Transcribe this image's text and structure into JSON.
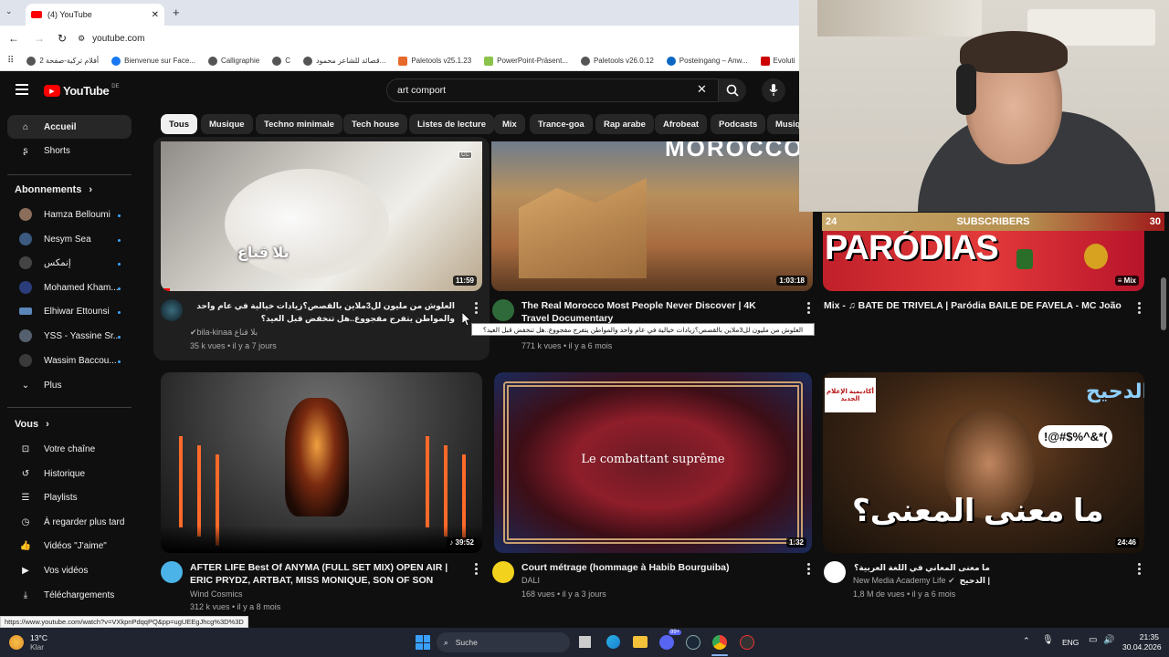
{
  "browser": {
    "tab_title": "(4) YouTube",
    "url": "youtube.com",
    "bookmarks": [
      "أفلام تركية-صفحة 2",
      "Bienvenue sur Face...",
      "Calligraphie",
      "C",
      "قصائد للشاعر محمود...",
      "Paletools v25.1.23",
      "PowerPoint-Präsent...",
      "Paletools v26.0.12",
      "Posteingang – Anw...",
      "Evoluti"
    ]
  },
  "youtube": {
    "logo_text": "YouTube",
    "region": "DE",
    "search_value": "art comport",
    "sidebar": {
      "main": [
        "Accueil",
        "Shorts"
      ],
      "subscriptions_heading": "Abonnements",
      "subscriptions": [
        "Hamza Belloumi",
        "Nesym Sea",
        "إنمكس",
        "Mohamed Kham...",
        "Elhiwar Ettounsi",
        "YSS - Yassine Sr...",
        "Wassim Baccou...",
        "Plus"
      ],
      "you_heading": "Vous",
      "you_items": [
        "Votre chaîne",
        "Historique",
        "Playlists",
        "À regarder plus tard",
        "Vidéos \"J'aime\"",
        "Vos vidéos",
        "Téléchargements"
      ]
    },
    "chips": [
      "Tous",
      "Musique",
      "Techno minimale",
      "Tech house",
      "Listes de lecture",
      "Mix",
      "Trance-goa",
      "Rap arabe",
      "Afrobeat",
      "Podcasts",
      "Musiq"
    ],
    "videos": [
      {
        "title": "العلوش من مليون لل3ملاين بالقصص؟زيادات خيالية في عام واحد والمواطن يتفرج مفجووع..هل تنخفض قبل العيد؟",
        "channel": "bila-kinaa بلا قناع",
        "meta": "35 k vues • il y a 7 jours",
        "duration": "11:59",
        "thumb_text": "بلا قناع"
      },
      {
        "title": "The Real Morocco Most People Never Discover | 4K Travel Documentary",
        "channel": "",
        "meta": "771 k vues • il y a 6 mois",
        "duration": "1:03:18",
        "thumb_text": "MOROCCO"
      },
      {
        "title": "Mix - ♫ BATE DE TRIVELA | Paródia BAILE DE FAVELA - MC João",
        "channel": "",
        "meta": "",
        "duration": "Mix",
        "thumb_text": "PARÓDIAS"
      },
      {
        "title": "AFTER LIFE Best Of ANYMA (FULL SET MIX) OPEN AIR | ERIC PRYDZ, ARTBAT, MISS MONIQUE, SON OF SON",
        "channel": "Wind Cosmics",
        "meta": "312 k vues • il y a 8 mois",
        "duration": "39:52",
        "thumb_text": ""
      },
      {
        "title": "Court métrage (hommage à Habib Bourguiba)",
        "channel": "DALI",
        "meta": "168 vues • il y a 3 jours",
        "duration": "1:32",
        "thumb_text": "Le combattant suprême"
      },
      {
        "title": "ما معنى المعاني في اللغة العربية؟ | الدحيح",
        "channel": "New Media Academy Life",
        "meta": "1,8 M de vues • il y a 6 mois",
        "duration": "24:46",
        "thumb_text": "ما معنى المعنى؟"
      }
    ],
    "tooltip": "العلوش من مليون لل3ملاين بالقصص؟زيادات خيالية في عام واحد والمواطن يتفرج مفجووع..هل تنخفض قبل العيد؟",
    "status_url": "https://www.youtube.com/watch?v=VXkpnPdqqPQ&pp=ugUEEgJhcg%3D%3D",
    "thumb_extra": {
      "alert_text": "!@#$%^&*(",
      "dahih_text": "الدحيح",
      "academy_text": "أكاديمية الإعلام الجديد"
    }
  },
  "overlay": {
    "subs_left": "24",
    "subs_label": "SUBSCRIBERS",
    "subs_right": "30"
  },
  "taskbar": {
    "temp": "13°C",
    "weather": "Klar",
    "search": "Suche",
    "lang": "ENG",
    "time": "21:35",
    "date": "30.04.2026",
    "badge": "99+"
  }
}
